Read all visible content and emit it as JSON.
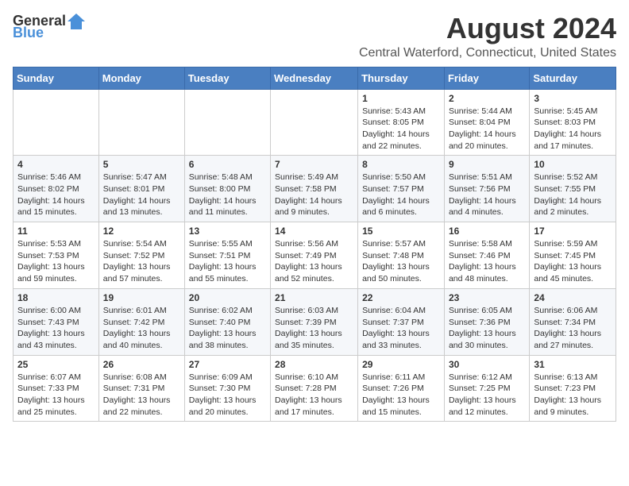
{
  "logo": {
    "general": "General",
    "blue": "Blue"
  },
  "header": {
    "title": "August 2024",
    "subtitle": "Central Waterford, Connecticut, United States"
  },
  "weekdays": [
    "Sunday",
    "Monday",
    "Tuesday",
    "Wednesday",
    "Thursday",
    "Friday",
    "Saturday"
  ],
  "weeks": [
    [
      {
        "day": "",
        "info": ""
      },
      {
        "day": "",
        "info": ""
      },
      {
        "day": "",
        "info": ""
      },
      {
        "day": "",
        "info": ""
      },
      {
        "day": "1",
        "info": "Sunrise: 5:43 AM\nSunset: 8:05 PM\nDaylight: 14 hours\nand 22 minutes."
      },
      {
        "day": "2",
        "info": "Sunrise: 5:44 AM\nSunset: 8:04 PM\nDaylight: 14 hours\nand 20 minutes."
      },
      {
        "day": "3",
        "info": "Sunrise: 5:45 AM\nSunset: 8:03 PM\nDaylight: 14 hours\nand 17 minutes."
      }
    ],
    [
      {
        "day": "4",
        "info": "Sunrise: 5:46 AM\nSunset: 8:02 PM\nDaylight: 14 hours\nand 15 minutes."
      },
      {
        "day": "5",
        "info": "Sunrise: 5:47 AM\nSunset: 8:01 PM\nDaylight: 14 hours\nand 13 minutes."
      },
      {
        "day": "6",
        "info": "Sunrise: 5:48 AM\nSunset: 8:00 PM\nDaylight: 14 hours\nand 11 minutes."
      },
      {
        "day": "7",
        "info": "Sunrise: 5:49 AM\nSunset: 7:58 PM\nDaylight: 14 hours\nand 9 minutes."
      },
      {
        "day": "8",
        "info": "Sunrise: 5:50 AM\nSunset: 7:57 PM\nDaylight: 14 hours\nand 6 minutes."
      },
      {
        "day": "9",
        "info": "Sunrise: 5:51 AM\nSunset: 7:56 PM\nDaylight: 14 hours\nand 4 minutes."
      },
      {
        "day": "10",
        "info": "Sunrise: 5:52 AM\nSunset: 7:55 PM\nDaylight: 14 hours\nand 2 minutes."
      }
    ],
    [
      {
        "day": "11",
        "info": "Sunrise: 5:53 AM\nSunset: 7:53 PM\nDaylight: 13 hours\nand 59 minutes."
      },
      {
        "day": "12",
        "info": "Sunrise: 5:54 AM\nSunset: 7:52 PM\nDaylight: 13 hours\nand 57 minutes."
      },
      {
        "day": "13",
        "info": "Sunrise: 5:55 AM\nSunset: 7:51 PM\nDaylight: 13 hours\nand 55 minutes."
      },
      {
        "day": "14",
        "info": "Sunrise: 5:56 AM\nSunset: 7:49 PM\nDaylight: 13 hours\nand 52 minutes."
      },
      {
        "day": "15",
        "info": "Sunrise: 5:57 AM\nSunset: 7:48 PM\nDaylight: 13 hours\nand 50 minutes."
      },
      {
        "day": "16",
        "info": "Sunrise: 5:58 AM\nSunset: 7:46 PM\nDaylight: 13 hours\nand 48 minutes."
      },
      {
        "day": "17",
        "info": "Sunrise: 5:59 AM\nSunset: 7:45 PM\nDaylight: 13 hours\nand 45 minutes."
      }
    ],
    [
      {
        "day": "18",
        "info": "Sunrise: 6:00 AM\nSunset: 7:43 PM\nDaylight: 13 hours\nand 43 minutes."
      },
      {
        "day": "19",
        "info": "Sunrise: 6:01 AM\nSunset: 7:42 PM\nDaylight: 13 hours\nand 40 minutes."
      },
      {
        "day": "20",
        "info": "Sunrise: 6:02 AM\nSunset: 7:40 PM\nDaylight: 13 hours\nand 38 minutes."
      },
      {
        "day": "21",
        "info": "Sunrise: 6:03 AM\nSunset: 7:39 PM\nDaylight: 13 hours\nand 35 minutes."
      },
      {
        "day": "22",
        "info": "Sunrise: 6:04 AM\nSunset: 7:37 PM\nDaylight: 13 hours\nand 33 minutes."
      },
      {
        "day": "23",
        "info": "Sunrise: 6:05 AM\nSunset: 7:36 PM\nDaylight: 13 hours\nand 30 minutes."
      },
      {
        "day": "24",
        "info": "Sunrise: 6:06 AM\nSunset: 7:34 PM\nDaylight: 13 hours\nand 27 minutes."
      }
    ],
    [
      {
        "day": "25",
        "info": "Sunrise: 6:07 AM\nSunset: 7:33 PM\nDaylight: 13 hours\nand 25 minutes."
      },
      {
        "day": "26",
        "info": "Sunrise: 6:08 AM\nSunset: 7:31 PM\nDaylight: 13 hours\nand 22 minutes."
      },
      {
        "day": "27",
        "info": "Sunrise: 6:09 AM\nSunset: 7:30 PM\nDaylight: 13 hours\nand 20 minutes."
      },
      {
        "day": "28",
        "info": "Sunrise: 6:10 AM\nSunset: 7:28 PM\nDaylight: 13 hours\nand 17 minutes."
      },
      {
        "day": "29",
        "info": "Sunrise: 6:11 AM\nSunset: 7:26 PM\nDaylight: 13 hours\nand 15 minutes."
      },
      {
        "day": "30",
        "info": "Sunrise: 6:12 AM\nSunset: 7:25 PM\nDaylight: 13 hours\nand 12 minutes."
      },
      {
        "day": "31",
        "info": "Sunrise: 6:13 AM\nSunset: 7:23 PM\nDaylight: 13 hours\nand 9 minutes."
      }
    ]
  ]
}
